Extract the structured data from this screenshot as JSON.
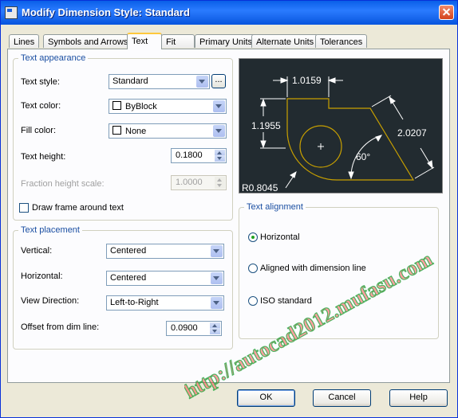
{
  "window": {
    "title": "Modify Dimension Style: Standard"
  },
  "tabs": [
    "Lines",
    "Symbols and Arrows",
    "Text",
    "Fit",
    "Primary Units",
    "Alternate Units",
    "Tolerances"
  ],
  "text_appearance": {
    "legend": "Text appearance",
    "text_style_label": "Text style:",
    "text_style_value": "Standard",
    "ellipsis": "...",
    "text_color_label": "Text color:",
    "text_color_value": "ByBlock",
    "fill_color_label": "Fill color:",
    "fill_color_value": "None",
    "text_height_label": "Text height:",
    "text_height_value": "0.1800",
    "fraction_label": "Fraction height scale:",
    "fraction_value": "1.0000",
    "draw_frame_label": "Draw frame around text"
  },
  "text_placement": {
    "legend": "Text placement",
    "vertical_label": "Vertical:",
    "vertical_value": "Centered",
    "horizontal_label": "Horizontal:",
    "horizontal_value": "Centered",
    "view_direction_label": "View Direction:",
    "view_direction_value": "Left-to-Right",
    "offset_label": "Offset from dim line:",
    "offset_value": "0.0900"
  },
  "preview": {
    "dim_top": "1.0159",
    "dim_left": "1.1955",
    "dim_right": "2.0207",
    "dim_angle": "60°",
    "dim_radius": "R0.8045",
    "colors": {
      "background": "#222b30",
      "shape": "#c8a000",
      "dims": "#ffffff"
    }
  },
  "text_alignment": {
    "legend": "Text alignment",
    "options": [
      "Horizontal",
      "Aligned with dimension line",
      "ISO standard"
    ],
    "selected": "Horizontal"
  },
  "buttons": {
    "ok": "OK",
    "cancel": "Cancel",
    "help": "Help"
  },
  "watermark": "http://autocad2012.mufasu.com"
}
